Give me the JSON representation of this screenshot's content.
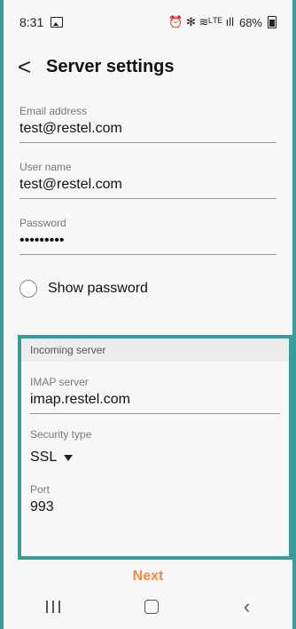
{
  "status_bar": {
    "time": "8:31",
    "icons_text": "⏰ ✻ ≋ᴸᵀᴱ ıll",
    "battery": "68%"
  },
  "app_bar": {
    "back_glyph": "<",
    "title": "Server settings"
  },
  "fields": {
    "email": {
      "label": "Email address",
      "value": "test@restel.com"
    },
    "username": {
      "label": "User name",
      "value": "test@restel.com"
    },
    "password": {
      "label": "Password",
      "value": "•••••••••"
    },
    "show_password": "Show password"
  },
  "incoming": {
    "section_title": "Incoming server",
    "imap": {
      "label": "IMAP server",
      "value": "imap.restel.com"
    },
    "security": {
      "label": "Security type",
      "value": "SSL"
    },
    "port": {
      "label": "Port",
      "value": "993"
    }
  },
  "actions": {
    "next_label": "Next"
  },
  "colors": {
    "accent_border": "#3a9c9a",
    "next_text": "#f58a3c"
  }
}
